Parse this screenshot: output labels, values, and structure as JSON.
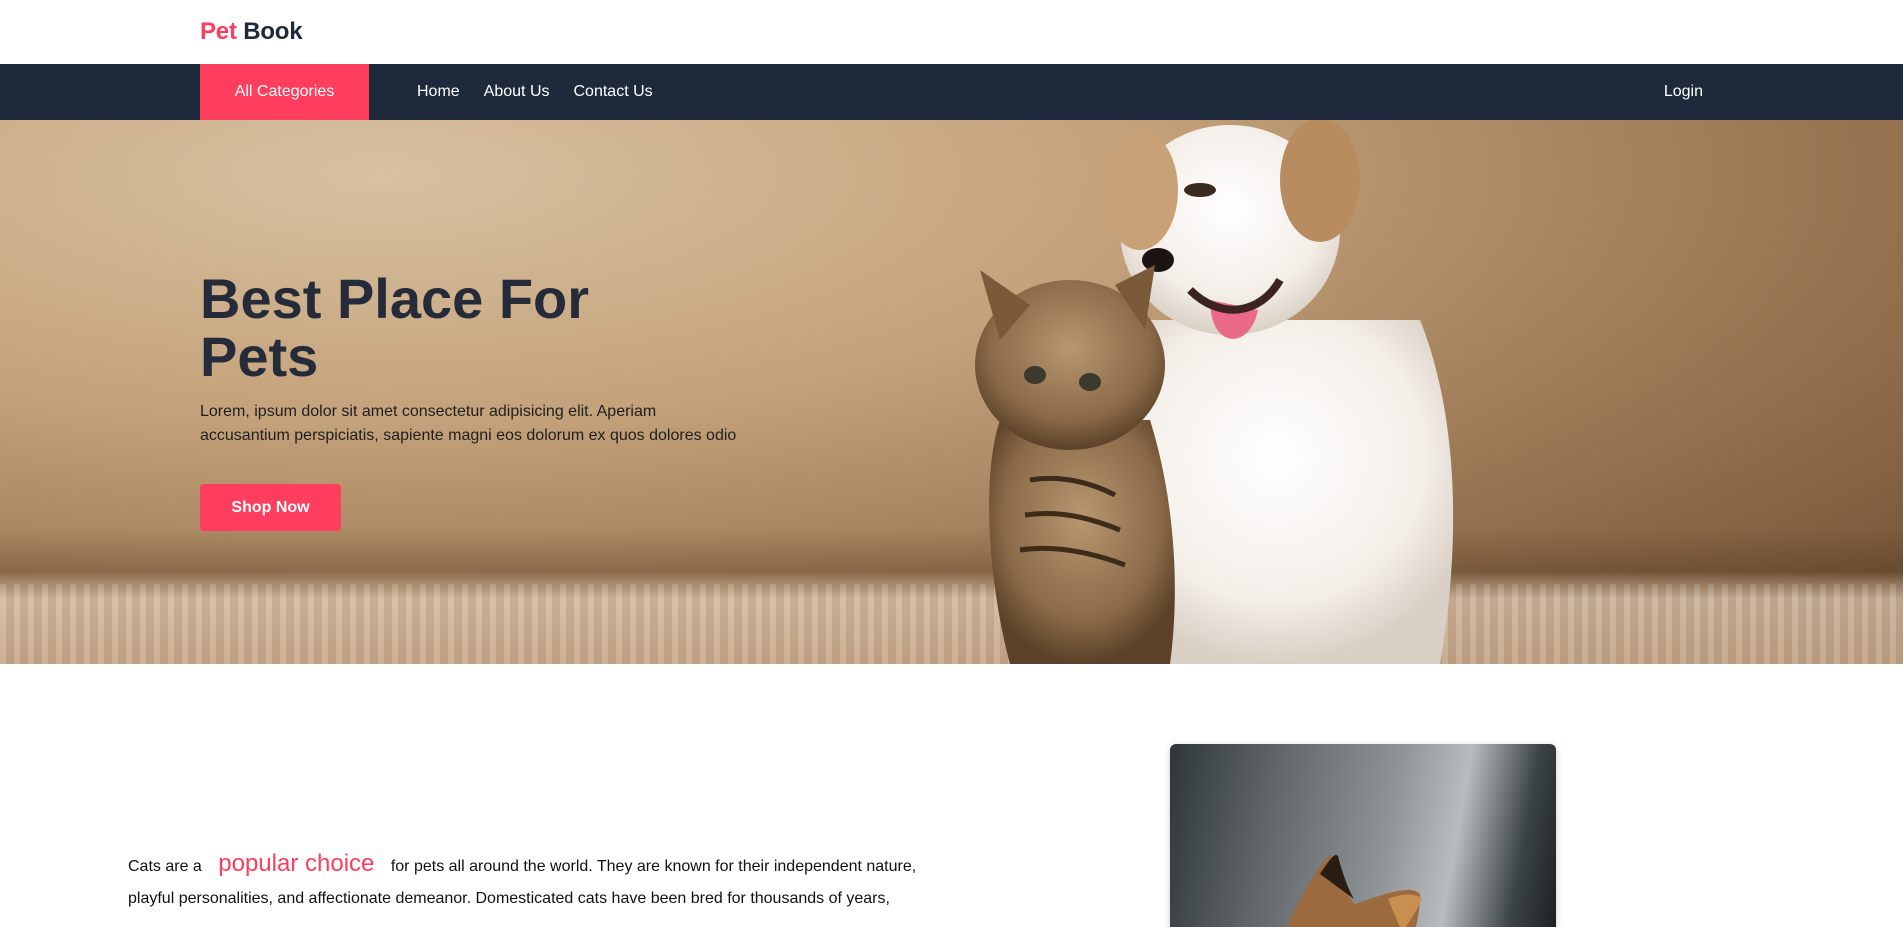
{
  "brand": {
    "part1": "Pet",
    "part2": "Book"
  },
  "nav": {
    "categories_label": "All Categories",
    "links": [
      "Home",
      "About Us",
      "Contact Us"
    ],
    "login_label": "Login"
  },
  "hero": {
    "title": "Best Place For Pets",
    "description": "Lorem, ipsum dolor sit amet consectetur adipisicing elit. Aperiam accusantium perspiciatis, sapiente magni eos dolorum ex quos dolores odio",
    "cta_label": "Shop Now"
  },
  "about": {
    "text_before": "Cats are a",
    "highlight": "popular choice",
    "text_after": "for pets all around the world. They are known for their independent nature, playful personalities, and affectionate demeanor. Domesticated cats have been bred for thousands of years,"
  },
  "colors": {
    "accent": "#ff3d5c",
    "navbar": "#1e293b",
    "heading": "#252b38"
  }
}
